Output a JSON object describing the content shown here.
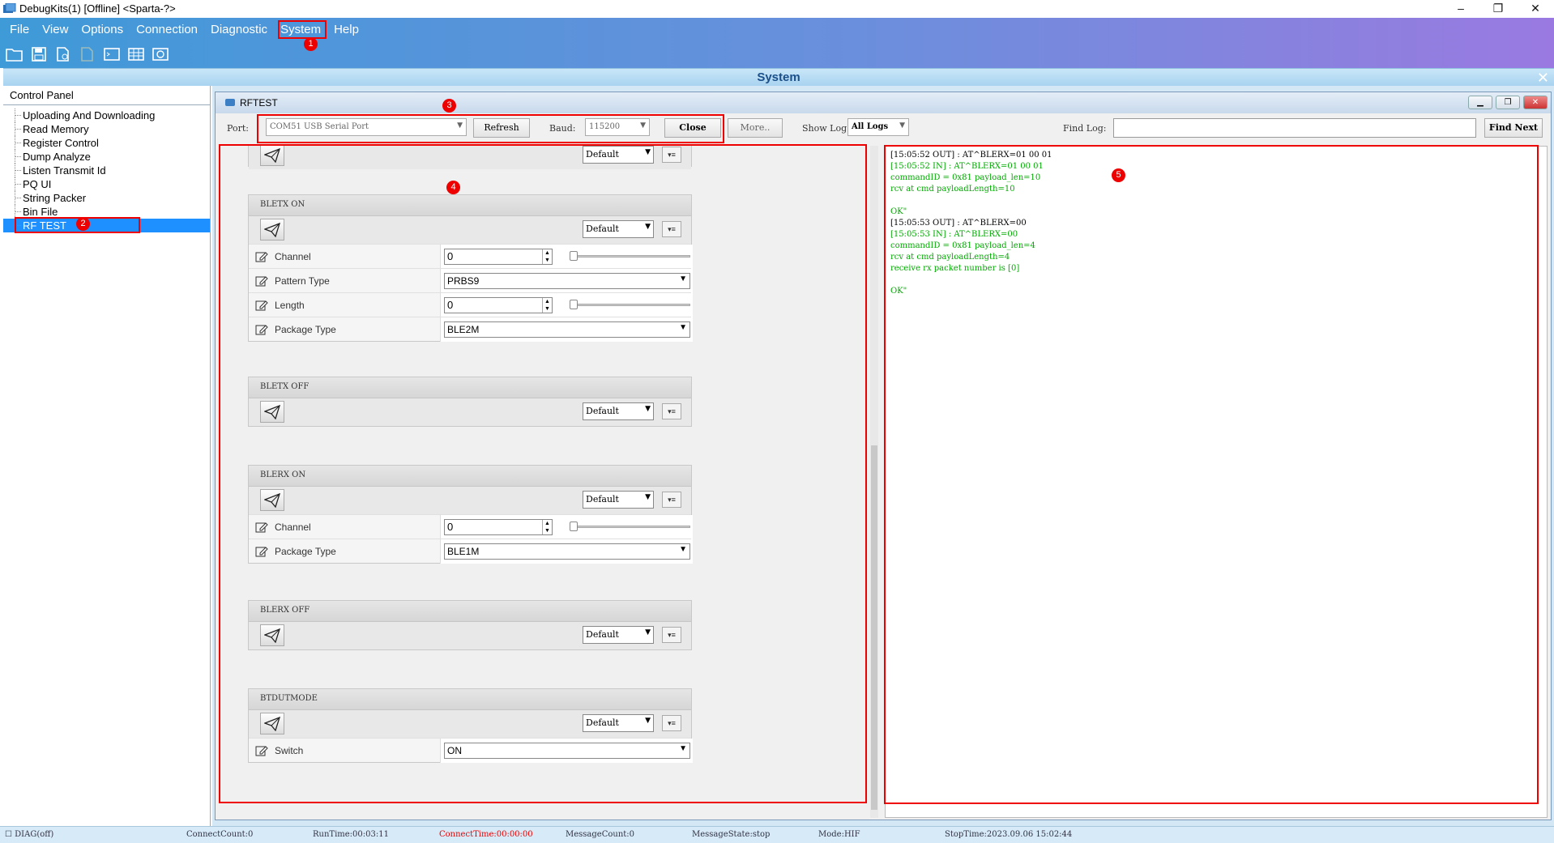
{
  "window": {
    "title": "DebugKits(1) [Offline] <Sparta-?>",
    "minimize": "–",
    "restore": "❐",
    "close": "✕"
  },
  "menu": [
    "File",
    "View",
    "Options",
    "Connection",
    "Diagnostic",
    "System",
    "Help"
  ],
  "system_panel": {
    "title": "System",
    "close": "✕"
  },
  "control_panel": {
    "title": "Control Panel",
    "items": [
      "Uploading And Downloading",
      "Read Memory",
      "Register Control",
      "Dump Analyze",
      "Listen Transmit Id",
      "PQ UI",
      "String Packer",
      "Bin File",
      "RF TEST"
    ],
    "selected": "RF TEST"
  },
  "rftest": {
    "title": "RFTEST",
    "port_label": "Port:",
    "port_value": "COM51  USB Serial Port",
    "refresh": "Refresh",
    "baud_label": "Baud:",
    "baud_value": "115200",
    "close": "Close",
    "more": "More..",
    "showlog_label": "Show Log",
    "showlog_value": "All Logs",
    "findlog_label": "Find Log:",
    "findnext": "Find Next"
  },
  "commands": [
    {
      "title": "BLETX ON",
      "preset": "Default",
      "params": [
        {
          "label": "Channel",
          "type": "spin",
          "value": "0"
        },
        {
          "label": "Pattern Type",
          "type": "select",
          "value": "PRBS9"
        },
        {
          "label": "Length",
          "type": "spin",
          "value": "0"
        },
        {
          "label": "Package Type",
          "type": "select",
          "value": "BLE2M"
        }
      ]
    },
    {
      "title": "BLETX OFF",
      "preset": "Default",
      "params": []
    },
    {
      "title": "BLERX ON",
      "preset": "Default",
      "params": [
        {
          "label": "Channel",
          "type": "spin",
          "value": "0"
        },
        {
          "label": "Package Type",
          "type": "select",
          "value": "BLE1M"
        }
      ]
    },
    {
      "title": "BLERX OFF",
      "preset": "Default",
      "params": []
    },
    {
      "title": "BTDUTMODE",
      "preset": "Default",
      "params": [
        {
          "label": "Switch",
          "type": "select",
          "value": "ON"
        }
      ]
    }
  ],
  "partial_top": {
    "preset": "Default"
  },
  "log": [
    {
      "t": "out",
      "text": "[15:05:52 OUT] : AT^BLERX=01 00 01"
    },
    {
      "t": "in",
      "text": "[15:05:52 IN] : AT^BLERX=01 00 01"
    },
    {
      "t": "in",
      "text": "commandID = 0x81 payload_len=10"
    },
    {
      "t": "in",
      "text": "rcv at cmd payloadLength=10"
    },
    {
      "t": "in",
      "text": ""
    },
    {
      "t": "in",
      "text": "OK\""
    },
    {
      "t": "out",
      "text": "[15:05:53 OUT] : AT^BLERX=00"
    },
    {
      "t": "in",
      "text": "[15:05:53 IN] : AT^BLERX=00"
    },
    {
      "t": "in",
      "text": "commandID = 0x81 payload_len=4"
    },
    {
      "t": "in",
      "text": "rcv at cmd payloadLength=4"
    },
    {
      "t": "in",
      "text": "receive rx packet number is [0]"
    },
    {
      "t": "in",
      "text": ""
    },
    {
      "t": "in",
      "text": "OK\""
    }
  ],
  "status": {
    "diag": "DIAG(off)",
    "connect_count": "ConnectCount:0",
    "runtime": "RunTime:00:03:11",
    "connect_time": "ConnectTime:00:00:00",
    "message_count": "MessageCount:0",
    "message_state": "MessageState:stop",
    "mode": "Mode:HIF",
    "stop_time": "StopTime:2023.09.06 15:02:44"
  },
  "markers": [
    "1",
    "2",
    "3",
    "4",
    "5"
  ],
  "colors": {
    "accent": "#1e90ff",
    "annotation": "#e00000",
    "log_in": "#00aa00",
    "connect_time": "#e00000"
  }
}
